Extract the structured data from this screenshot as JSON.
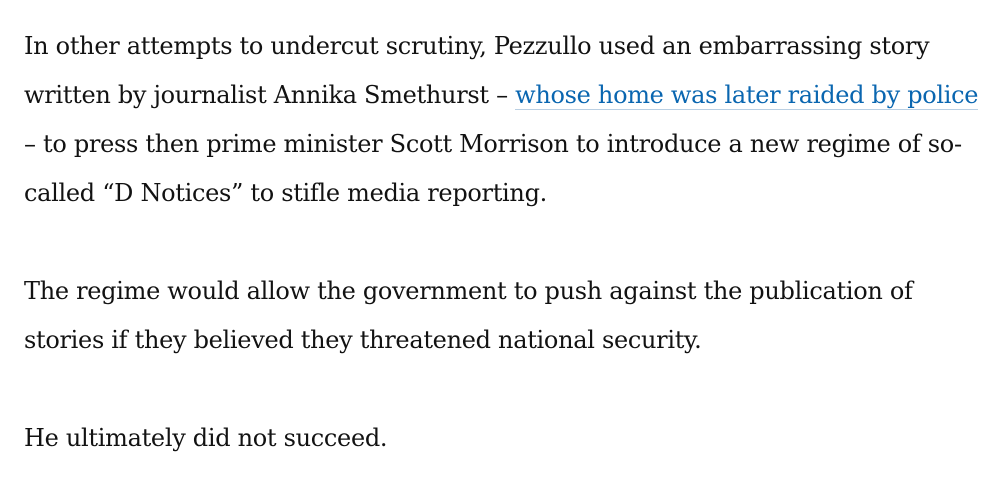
{
  "article": {
    "paragraph1": {
      "before_link": "In other attempts to undercut scrutiny, Pezzullo used an embarrassing story written by journalist Annika Smethurst – ",
      "link_text": "whose home was later raided by police",
      "after_link": " – to press then prime minister Scott Morrison to introduce a new regime of so-called “D Notices” to stifle media reporting."
    },
    "paragraph2": "The regime would allow the government to push against the publication of stories if they believed they threatened national security.",
    "paragraph3": "He ultimately did not succeed."
  },
  "colors": {
    "text": "#121212",
    "link": "#0a66b0",
    "link_underline": "#b9cfe3",
    "background": "#ffffff"
  }
}
